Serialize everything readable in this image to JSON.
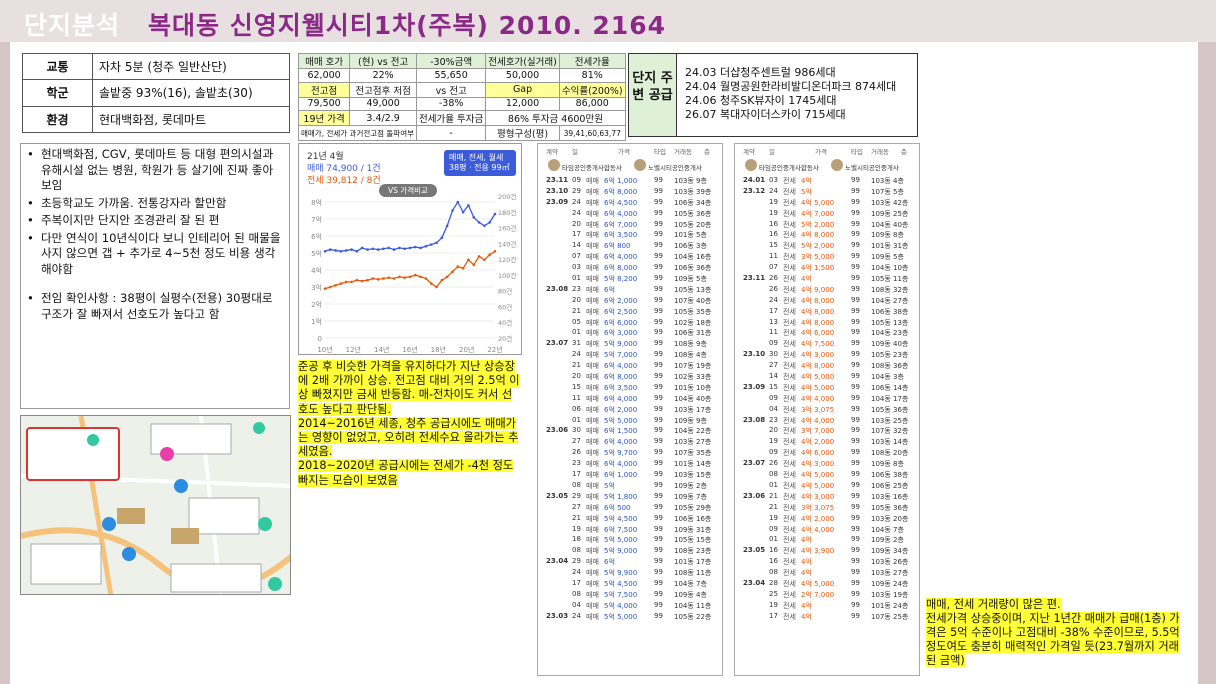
{
  "header": {
    "title": "단지분석",
    "subtitle": "복대동 신영지웰시티1차(주복) 2010. 2164"
  },
  "info_table": [
    {
      "k": "교통",
      "v": "자차 5분 (청주 일반산단)"
    },
    {
      "k": "학군",
      "v": "솔밭중 93%(16), 솔밭초(30)"
    },
    {
      "k": "환경",
      "v": "현대백화점, 롯데마트"
    }
  ],
  "price_table": {
    "rows": [
      [
        "매매 호가",
        "(현) vs 전고",
        "-30%금액",
        "전세호가(실거래)",
        "전세가율"
      ],
      [
        "62,000",
        "22%",
        "55,650",
        "50,000",
        "81%"
      ],
      [
        "전고점",
        "전고점후 저점",
        "vs 전고",
        "Gap",
        "수익률(200%)"
      ],
      [
        "79,500",
        "49,000",
        "-38%",
        "12,000",
        "86,000"
      ],
      [
        "19년 가격",
        "3.4/2.9",
        "전세가율 투자금",
        "86% 투자금 4600만원",
        ""
      ],
      [
        "매매가, 전세가 과거전고점 돌파여부",
        "",
        "-",
        "평형구성(평)",
        "39,41,60,63,77"
      ]
    ]
  },
  "supply": {
    "label": "단지 주변 공급",
    "items": [
      "24.03 더샵청주센트럴 986세대",
      "24.04 월명공원한라비발디온더파크 874세대",
      "24.06 청주SK뷰자이 1745세대",
      "26.07 복대자이더스카이 715세대"
    ]
  },
  "bullets": [
    "현대백화점, CGV, 롯데마트 등 대형 편의시설과 유해시설 없는 병원, 학원가 등 살기에 진짜 좋아 보임",
    "초등학교도 가까움. 전통강자라 할만함",
    "주복이지만 단지안 조경관리 잘 된 편",
    "다만 연식이 10년식이다 보니 인테리어 된 매물을 사지 않으면 갭 + 추가로 4~5천 정도 비용 생각해야함",
    "전임 확인사항 : 38평이 실평수(전용) 30평대로 구조가 잘 빠져서 선호도가 높다고 함"
  ],
  "price_chart": {
    "title": "21년 4월",
    "sale_label": "매매 74,900 / 1건",
    "rent_label": "전세 39,812 / 8건",
    "filter_label": "매매, 전세, 월세",
    "filter_sub": "38평 · 전용 99㎡",
    "compare_label": "VS 가격비교",
    "sale_color": "#3b5bdb",
    "rent_color": "#e8590c"
  },
  "chart_data": {
    "type": "line",
    "x": [
      "10년",
      "12년",
      "14년",
      "16년",
      "18년",
      "20년",
      "22년"
    ],
    "y_left_ticks": [
      "8억",
      "7억",
      "6억",
      "5억",
      "4억",
      "3억",
      "2억",
      "1억",
      "0"
    ],
    "y_right_ticks": [
      "200건",
      "180건",
      "160건",
      "140건",
      "120건",
      "100건",
      "80건",
      "60건",
      "40건",
      "20건"
    ],
    "series": [
      {
        "name": "매매",
        "values": [
          5.1,
          5.2,
          5.15,
          5.1,
          5.15,
          5.2,
          5.1,
          5.3,
          5.2,
          5.25,
          5.2,
          5.25,
          5.3,
          5.2,
          5.3,
          5.25,
          5.3,
          5.35,
          5.3,
          5.4,
          5.5,
          5.6,
          5.9,
          6.6,
          7.5,
          8.0,
          7.4,
          7.8,
          7.1,
          6.8,
          6.6,
          6.8,
          7.3
        ]
      },
      {
        "name": "전세",
        "values": [
          2.9,
          3.0,
          3.1,
          3.2,
          3.3,
          3.3,
          3.4,
          3.35,
          3.4,
          3.5,
          3.45,
          3.5,
          3.55,
          3.5,
          3.6,
          3.55,
          3.6,
          3.7,
          3.6,
          3.5,
          3.2,
          3.0,
          3.4,
          3.6,
          3.9,
          4.2,
          4.1,
          4.6,
          4.3,
          4.8,
          4.6,
          4.9,
          5.1
        ]
      }
    ]
  },
  "notes": [
    "준공 후 비슷한 가격을 유지하다가 지난 상승장에 2배 가까이 상승. 전고점 대비 거의 2.5억 이상 빠졌지만 금새 반등함. 매-전차이도 커서 선호도 높다고 판단됨.",
    "2014~2016년 세종, 청주 공급시에도 매매가는 영향이 없었고, 오히려 전세수요 올라가는 추세였음.",
    "2018~2020년 공급시에는 전세가 -4천 정도 빠지는 모습이 보였음"
  ],
  "list1": {
    "head": [
      "계약",
      "일",
      "가격",
      "타입",
      "거래동",
      "층"
    ],
    "agents": [
      "타임공인중개사합동사",
      "노벨시티공인중개사"
    ],
    "rows": [
      [
        "23.11",
        "09",
        "매매",
        "6억 1,000",
        "99",
        "103동",
        "9층",
        "sale"
      ],
      [
        "23.10",
        "29",
        "매매",
        "6억 8,000",
        "99",
        "103동",
        "39층",
        "sale"
      ],
      [
        "23.09",
        "24",
        "매매",
        "6억 4,500",
        "99",
        "106동",
        "34층",
        "sale"
      ],
      [
        "",
        "24",
        "매매",
        "6억 4,000",
        "99",
        "105동",
        "36층",
        "sale"
      ],
      [
        "",
        "20",
        "매매",
        "6억 7,000",
        "99",
        "105동",
        "20층",
        "sale"
      ],
      [
        "",
        "17",
        "매매",
        "6억 3,500",
        "99",
        "101동",
        "5층",
        "sale"
      ],
      [
        "",
        "14",
        "매매",
        "6억 800",
        "99",
        "106동",
        "3층",
        "sale"
      ],
      [
        "",
        "07",
        "매매",
        "6억 4,000",
        "99",
        "104동",
        "16층",
        "sale"
      ],
      [
        "",
        "03",
        "매매",
        "6억 8,000",
        "99",
        "106동",
        "36층",
        "sale"
      ],
      [
        "",
        "01",
        "매매",
        "5억 8,200",
        "99",
        "109동",
        "5층",
        "sale"
      ],
      [
        "23.08",
        "23",
        "매매",
        "6억",
        "99",
        "105동",
        "13층",
        "sale"
      ],
      [
        "",
        "20",
        "매매",
        "6억 2,000",
        "99",
        "107동",
        "40층",
        "sale"
      ],
      [
        "",
        "21",
        "매매",
        "6억 2,500",
        "99",
        "105동",
        "35층",
        "sale"
      ],
      [
        "",
        "05",
        "매매",
        "6억 6,000",
        "99",
        "102동",
        "18층",
        "sale"
      ],
      [
        "",
        "01",
        "매매",
        "6억 3,000",
        "99",
        "106동",
        "31층",
        "sale"
      ],
      [
        "23.07",
        "31",
        "매매",
        "5억 9,000",
        "99",
        "108동",
        "9층",
        "sale"
      ],
      [
        "",
        "24",
        "매매",
        "5억 7,000",
        "99",
        "108동",
        "4층",
        "sale"
      ],
      [
        "",
        "21",
        "매매",
        "6억 4,000",
        "99",
        "107동",
        "19층",
        "sale"
      ],
      [
        "",
        "20",
        "매매",
        "6억 8,000",
        "99",
        "102동",
        "33층",
        "sale"
      ],
      [
        "",
        "15",
        "매매",
        "6억 3,500",
        "99",
        "101동",
        "10층",
        "sale"
      ],
      [
        "",
        "11",
        "매매",
        "6억 4,000",
        "99",
        "104동",
        "40층",
        "sale"
      ],
      [
        "",
        "06",
        "매매",
        "6억 2,000",
        "99",
        "103동",
        "17층",
        "sale"
      ],
      [
        "",
        "01",
        "매매",
        "5억 5,000",
        "99",
        "109동",
        "9층",
        "sale"
      ],
      [
        "23.06",
        "30",
        "매매",
        "6억 1,500",
        "99",
        "104동",
        "22층",
        "sale"
      ],
      [
        "",
        "27",
        "매매",
        "6억 4,000",
        "99",
        "103동",
        "27층",
        "sale"
      ],
      [
        "",
        "26",
        "매매",
        "5억 9,700",
        "99",
        "107동",
        "35층",
        "sale"
      ],
      [
        "",
        "23",
        "매매",
        "6억 4,000",
        "99",
        "101동",
        "14층",
        "sale"
      ],
      [
        "",
        "17",
        "매매",
        "6억 1,000",
        "99",
        "103동",
        "15층",
        "sale"
      ],
      [
        "",
        "08",
        "매매",
        "5억",
        "99",
        "109동",
        "2층",
        "sale"
      ],
      [
        "23.05",
        "29",
        "매매",
        "5억 1,800",
        "99",
        "109동",
        "7층",
        "sale"
      ],
      [
        "",
        "27",
        "매매",
        "6억 500",
        "99",
        "105동",
        "29층",
        "sale"
      ],
      [
        "",
        "21",
        "매매",
        "5억 4,500",
        "99",
        "106동",
        "16층",
        "sale"
      ],
      [
        "",
        "19",
        "매매",
        "6억 7,500",
        "99",
        "109동",
        "31층",
        "sale"
      ],
      [
        "",
        "18",
        "매매",
        "5억 5,000",
        "99",
        "105동",
        "15층",
        "sale"
      ],
      [
        "",
        "08",
        "매매",
        "5억 9,000",
        "99",
        "108동",
        "23층",
        "sale"
      ],
      [
        "23.04",
        "29",
        "매매",
        "6억",
        "99",
        "101동",
        "17층",
        "sale"
      ],
      [
        "",
        "24",
        "매매",
        "5억 9,900",
        "99",
        "108동",
        "11층",
        "sale"
      ],
      [
        "",
        "17",
        "매매",
        "5억 4,500",
        "99",
        "104동",
        "7층",
        "sale"
      ],
      [
        "",
        "08",
        "매매",
        "5억 7,500",
        "99",
        "109동",
        "4층",
        "sale"
      ],
      [
        "",
        "04",
        "매매",
        "5억 4,000",
        "99",
        "104동",
        "11층",
        "sale"
      ],
      [
        "23.03",
        "24",
        "매매",
        "5억 5,000",
        "99",
        "105동",
        "22층",
        "sale"
      ]
    ]
  },
  "list2": {
    "head": [
      "계약",
      "일",
      "가격",
      "타입",
      "거래동",
      "층"
    ],
    "agents": [
      "타임공인중개사합동사",
      "노벨시티공인중개사"
    ],
    "rows": [
      [
        "24.01",
        "03",
        "전세",
        "4억",
        "99",
        "103동",
        "4층",
        "rent"
      ],
      [
        "23.12",
        "24",
        "전세",
        "5억",
        "99",
        "107동",
        "5층",
        "rent"
      ],
      [
        "",
        "19",
        "전세",
        "4억 5,000",
        "99",
        "103동",
        "42층",
        "rent"
      ],
      [
        "",
        "19",
        "전세",
        "4억 7,000",
        "99",
        "109동",
        "25층",
        "rent"
      ],
      [
        "",
        "16",
        "전세",
        "5억 2,000",
        "99",
        "104동",
        "40층",
        "rent"
      ],
      [
        "",
        "16",
        "전세",
        "4억 8,000",
        "99",
        "109동",
        "8층",
        "rent"
      ],
      [
        "",
        "15",
        "전세",
        "5억 2,000",
        "99",
        "101동",
        "31층",
        "rent"
      ],
      [
        "",
        "11",
        "전세",
        "3억 5,000",
        "99",
        "109동",
        "5층",
        "rent"
      ],
      [
        "",
        "07",
        "전세",
        "4억 1,500",
        "99",
        "104동",
        "10층",
        "rent"
      ],
      [
        "23.11",
        "26",
        "전세",
        "4억",
        "99",
        "105동",
        "11층",
        "rent"
      ],
      [
        "",
        "26",
        "전세",
        "4억 9,000",
        "99",
        "108동",
        "32층",
        "rent"
      ],
      [
        "",
        "24",
        "전세",
        "4억 8,000",
        "99",
        "104동",
        "27층",
        "rent"
      ],
      [
        "",
        "17",
        "전세",
        "4억 8,000",
        "99",
        "106동",
        "38층",
        "rent"
      ],
      [
        "",
        "13",
        "전세",
        "4억 8,000",
        "99",
        "105동",
        "13층",
        "rent"
      ],
      [
        "",
        "11",
        "전세",
        "4억 6,000",
        "99",
        "104동",
        "23층",
        "rent"
      ],
      [
        "",
        "09",
        "전세",
        "4억 7,500",
        "99",
        "109동",
        "40층",
        "rent"
      ],
      [
        "23.10",
        "30",
        "전세",
        "4억 3,000",
        "99",
        "105동",
        "23층",
        "rent"
      ],
      [
        "",
        "27",
        "전세",
        "4억 8,000",
        "99",
        "108동",
        "36층",
        "rent"
      ],
      [
        "",
        "14",
        "전세",
        "4억 5,000",
        "99",
        "104동",
        "3층",
        "rent"
      ],
      [
        "23.09",
        "15",
        "전세",
        "4억 5,000",
        "99",
        "106동",
        "14층",
        "rent"
      ],
      [
        "",
        "09",
        "전세",
        "4억 4,000",
        "99",
        "104동",
        "17층",
        "rent"
      ],
      [
        "",
        "04",
        "전세",
        "3억 3,075",
        "99",
        "105동",
        "36층",
        "rent"
      ],
      [
        "23.08",
        "23",
        "전세",
        "4억 4,000",
        "99",
        "103동",
        "25층",
        "rent"
      ],
      [
        "",
        "20",
        "전세",
        "3억 7,000",
        "99",
        "107동",
        "32층",
        "rent"
      ],
      [
        "",
        "19",
        "전세",
        "4억 2,000",
        "99",
        "103동",
        "14층",
        "rent"
      ],
      [
        "",
        "09",
        "전세",
        "4억 6,000",
        "99",
        "108동",
        "20층",
        "rent"
      ],
      [
        "23.07",
        "26",
        "전세",
        "4억 3,000",
        "99",
        "109동",
        "8층",
        "rent"
      ],
      [
        "",
        "08",
        "전세",
        "4억 5,000",
        "99",
        "106동",
        "38층",
        "rent"
      ],
      [
        "",
        "01",
        "전세",
        "4억 5,000",
        "99",
        "106동",
        "25층",
        "rent"
      ],
      [
        "23.06",
        "21",
        "전세",
        "4억 3,000",
        "99",
        "103동",
        "16층",
        "rent"
      ],
      [
        "",
        "21",
        "전세",
        "3억 3,075",
        "99",
        "105동",
        "36층",
        "rent"
      ],
      [
        "",
        "19",
        "전세",
        "4억 2,000",
        "99",
        "103동",
        "20층",
        "rent"
      ],
      [
        "",
        "09",
        "전세",
        "4억 4,000",
        "99",
        "104동",
        "7층",
        "rent"
      ],
      [
        "",
        "01",
        "전세",
        "4억",
        "99",
        "109동",
        "2층",
        "rent"
      ],
      [
        "23.05",
        "16",
        "전세",
        "4억 3,900",
        "99",
        "109동",
        "34층",
        "rent"
      ],
      [
        "",
        "16",
        "전세",
        "4억",
        "99",
        "103동",
        "26층",
        "rent"
      ],
      [
        "",
        "08",
        "전세",
        "4억",
        "99",
        "103동",
        "27층",
        "rent"
      ],
      [
        "23.04",
        "28",
        "전세",
        "4억 5,000",
        "99",
        "109동",
        "24층",
        "rent"
      ],
      [
        "",
        "25",
        "전세",
        "2억 7,000",
        "99",
        "103동",
        "19층",
        "rent"
      ],
      [
        "",
        "19",
        "전세",
        "4억",
        "99",
        "101동",
        "24층",
        "rent"
      ],
      [
        "",
        "17",
        "전세",
        "4억",
        "99",
        "107동",
        "25층",
        "rent"
      ]
    ]
  },
  "conclusion": [
    "매매, 전세 거래량이 많은 편.",
    "전세가격 상승중이며, 지난 1년간 매매가 급매(1층) 가격은 5억 수준이나 고점대비 -38% 수준이므로, 5.5억 정도여도 충분히 매력적인 가격일 듯(23.7월까지 거래된 금액)"
  ]
}
